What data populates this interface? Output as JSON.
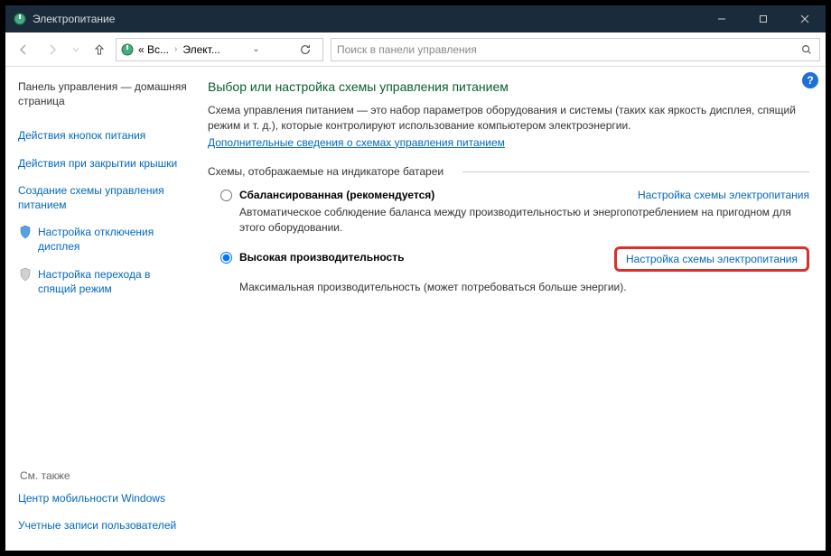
{
  "window": {
    "title": "Электропитание",
    "min_tooltip": "Minimize",
    "max_tooltip": "Maximize",
    "close_tooltip": "Close"
  },
  "nav": {
    "crumb1": "« Вс...",
    "crumb2": "Элект...",
    "search_placeholder": "Поиск в панели управления"
  },
  "sidebar": {
    "home": "Панель управления — домашняя страница",
    "link_buttons": "Действия кнопок питания",
    "link_lid": "Действия при закрытии крышки",
    "link_create": "Создание схемы управления питанием",
    "link_display": "Настройка отключения дисплея",
    "link_sleep": "Настройка перехода в спящий режим",
    "see_also": "См. также",
    "link_mobility": "Центр мобильности Windows",
    "link_accounts": "Учетные записи пользователей"
  },
  "main": {
    "heading": "Выбор или настройка схемы управления питанием",
    "desc": "Схема управления питанием — это набор параметров оборудования и системы (таких как яркость дисплея, спящий режим и т. д.), которые контролируют использование компьютером электроэнергии.",
    "more_link": "Дополнительные сведения о схемах управления питанием",
    "fieldset_label": "Схемы, отображаемые на индикаторе батареи",
    "help_badge": "?"
  },
  "plans": {
    "balanced": {
      "name": "Сбалансированная (рекомендуется)",
      "desc": "Автоматическое соблюдение баланса между производительностью и энергопотреблением на пригодном для этого оборудовании.",
      "configure": "Настройка схемы электропитания"
    },
    "high_perf": {
      "name": "Высокая производительность",
      "desc": "Максимальная производительность (может потребоваться больше энергии).",
      "configure": "Настройка схемы электропитания"
    }
  }
}
